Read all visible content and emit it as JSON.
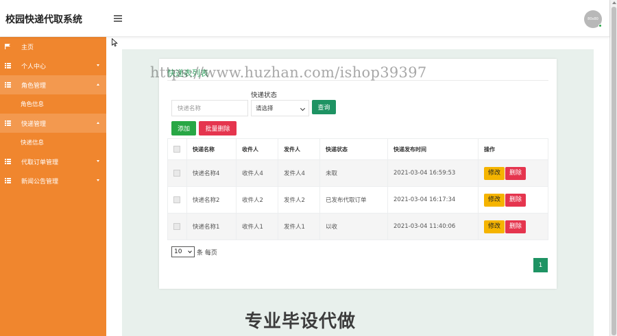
{
  "header": {
    "app_title": "校园快递代取系统",
    "avatar_text": "80x80"
  },
  "sidebar": {
    "items": [
      {
        "label": "主页",
        "icon": "flag-icon"
      },
      {
        "label": "个人中心",
        "icon": "list-icon"
      },
      {
        "label": "角色管理",
        "icon": "list-icon",
        "open": true,
        "children": [
          "角色信息"
        ]
      },
      {
        "label": "快递管理",
        "icon": "list-icon",
        "open": true,
        "children": [
          "快递信息"
        ]
      },
      {
        "label": "代取订单管理",
        "icon": "list-icon"
      },
      {
        "label": "新闻公告管理",
        "icon": "list-icon"
      }
    ]
  },
  "main": {
    "card_title": "快递表列表",
    "filters": {
      "name_placeholder": "快递名称",
      "status_label": "快递状态",
      "status_selected": "请选择",
      "search_label": "查询"
    },
    "actions": {
      "add_label": "添加",
      "batch_delete_label": "批量删除"
    },
    "table": {
      "columns": [
        "快递名称",
        "收件人",
        "发件人",
        "快递状态",
        "快递发布时间",
        "操作"
      ],
      "rows": [
        {
          "name": "快递名称4",
          "receiver": "收件人4",
          "sender": "发件人4",
          "status": "未取",
          "time": "2021-03-04 16:59:53"
        },
        {
          "name": "快递名称2",
          "receiver": "收件人2",
          "sender": "发件人2",
          "status": "已发布代取订单",
          "time": "2021-03-04 16:17:34"
        },
        {
          "name": "快递名称1",
          "receiver": "收件人1",
          "sender": "发件人1",
          "status": "以收",
          "time": "2021-03-04 11:40:06"
        }
      ],
      "edit_label": "修改",
      "delete_label": "删除"
    },
    "pagination": {
      "page_size": "10",
      "page_size_suffix": "条 每页",
      "current_page": "1"
    }
  },
  "overlay": {
    "watermark": "https://www.huzhan.com/ishop39397",
    "promo": "专业毕设代做"
  },
  "colors": {
    "sidebar_bg": "#f0862e",
    "primary_green": "#1e9363",
    "danger_red": "#e5354e",
    "warning_yellow": "#f5b400"
  }
}
